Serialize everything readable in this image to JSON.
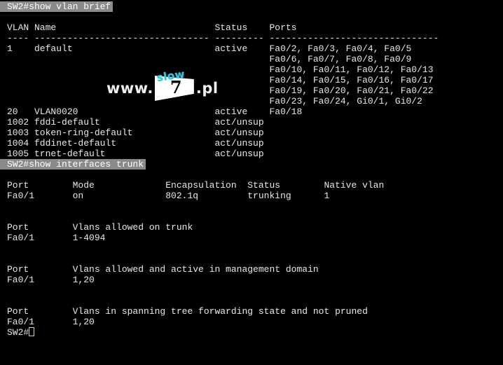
{
  "terminal": {
    "prompt": "SW2#",
    "background_color": "#000000",
    "text_color": "#e8e8e8",
    "highlight_color": "#8a8a8a",
    "cursor_color": "#d8d6a8"
  },
  "commands": {
    "first": "SW2#show vlan brief",
    "second": "SW2#show interfaces trunk"
  },
  "vlan_table": {
    "header": "VLAN Name                             Status    Ports",
    "separator": "---- -------------------------------- --------- -------------------------------",
    "rows": [
      "1    default                          active    Fa0/2, Fa0/3, Fa0/4, Fa0/5",
      "                                                Fa0/6, Fa0/7, Fa0/8, Fa0/9",
      "                                                Fa0/10, Fa0/11, Fa0/12, Fa0/13",
      "                                                Fa0/14, Fa0/15, Fa0/16, Fa0/17",
      "                                                Fa0/19, Fa0/20, Fa0/21, Fa0/22",
      "                                                Fa0/23, Fa0/24, Gi0/1, Gi0/2",
      "20   VLAN0020                         active    Fa0/18",
      "1002 fddi-default                     act/unsup",
      "1003 token-ring-default               act/unsup",
      "1004 fddinet-default                  act/unsup",
      "1005 trnet-default                    act/unsup"
    ]
  },
  "trunk_output": {
    "block1": {
      "header": "Port        Mode             Encapsulation  Status        Native vlan",
      "row": "Fa0/1       on               802.1q         trunking      1"
    },
    "block2": {
      "header": "Port        Vlans allowed on trunk",
      "row": "Fa0/1       1-4094"
    },
    "block3": {
      "header": "Port        Vlans allowed and active in management domain",
      "row": "Fa0/1       1,20"
    },
    "block4": {
      "header": "Port        Vlans in spanning tree forwarding state and not pruned",
      "row": "Fa0/1       1,20"
    }
  },
  "watermark": {
    "text_left": "www.",
    "logo_top": "slow",
    "logo_number": "7",
    "text_right": ".pl"
  }
}
